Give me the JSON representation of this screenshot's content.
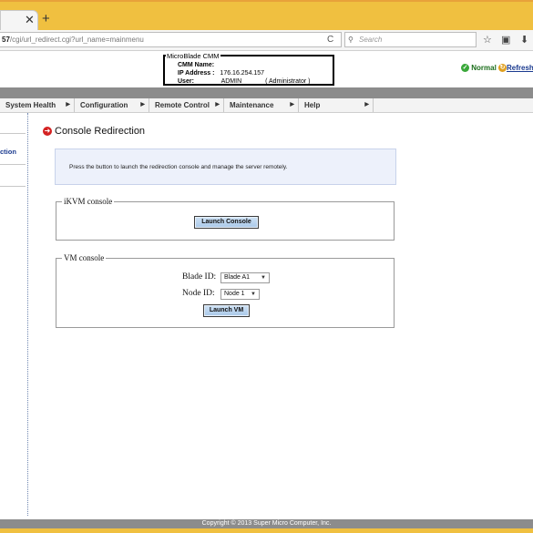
{
  "browser": {
    "url_bold": "57",
    "url_rest": "/cgi/url_redirect.cgi?url_name=mainmenu",
    "search_placeholder": "Search"
  },
  "header": {
    "cmm_title": "MicroBlade CMM",
    "cmm_name_label": "CMM Name:",
    "cmm_name_value": "",
    "ip_label": "IP Address :",
    "ip_value": "176.16.254.157",
    "user_label": "User:",
    "user_value": "ADMIN",
    "user_role": "( Administrator )",
    "status_text": "Normal",
    "refresh_text": "Refresh"
  },
  "menu": {
    "items": [
      {
        "label": "System Health"
      },
      {
        "label": "Configuration"
      },
      {
        "label": "Remote Control"
      },
      {
        "label": "Maintenance"
      },
      {
        "label": "Help"
      }
    ]
  },
  "sidebar": {
    "active_item": "ction"
  },
  "main": {
    "title": "Console Redirection",
    "info_text": "Press the button to launch the redirection console and manage the server remotely.",
    "ikvm": {
      "legend": "iKVM console",
      "launch_label": "Launch Console"
    },
    "vm": {
      "legend": "VM console",
      "blade_label": "Blade ID:",
      "blade_value": "Blade A1",
      "node_label": "Node ID:",
      "node_value": "Node 1",
      "launch_label": "Launch VM"
    }
  },
  "footer": {
    "copyright": "Copyright © 2013 Super Micro Computer, Inc."
  }
}
